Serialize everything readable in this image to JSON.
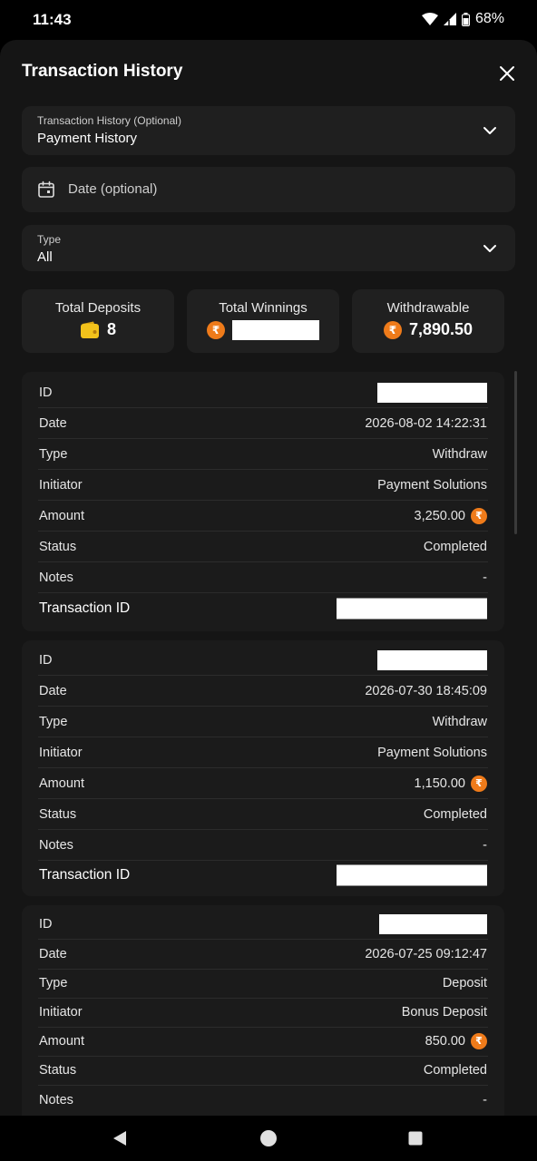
{
  "status_bar": {
    "time": "11:43",
    "battery": "68%"
  },
  "sheet": {
    "title": "Transaction History",
    "sort_field": {
      "label": "Transaction History (Optional)",
      "value": "Payment History"
    },
    "date_field": {
      "placeholder": "Date (optional)"
    },
    "type_field": {
      "label": "Type",
      "value": "All"
    }
  },
  "summary": {
    "deposits": {
      "label": "Total Deposits",
      "value": "8"
    },
    "winnings": {
      "label": "Total Winnings",
      "value": ""
    },
    "withdrawable": {
      "label": "Withdrawable",
      "value": "7,890.50"
    }
  },
  "currency_symbol": "₹",
  "field_labels": {
    "id": "ID",
    "date": "Date",
    "type": "Type",
    "initiator": "Initiator",
    "amount": "Amount",
    "status": "Status",
    "notes": "Notes",
    "transaction_id": "Transaction ID"
  },
  "transactions": [
    {
      "date": "2026-08-02 14:22:31",
      "type": "Withdraw",
      "initiator": "Payment Solutions",
      "amount": "3,250.00",
      "status": "Completed",
      "notes": "-"
    },
    {
      "date": "2026-07-30 18:45:09",
      "type": "Withdraw",
      "initiator": "Payment Solutions",
      "amount": "1,150.00",
      "status": "Completed",
      "notes": "-"
    },
    {
      "date": "2026-07-25 09:12:47",
      "type": "Deposit",
      "initiator": "Bonus Deposit",
      "amount": "850.00",
      "status": "Completed",
      "notes": "-"
    }
  ],
  "colors": {
    "background": "#151515",
    "card": "#1b1b1b",
    "accent_coin": "#ef7b1a",
    "wallet": "#f2c21b"
  },
  "icons": [
    "wifi-icon",
    "signal-icon",
    "battery-icon",
    "close-icon",
    "chevron-down-icon",
    "calendar-icon",
    "wallet-icon",
    "rupee-coin-icon",
    "back-icon",
    "home-icon",
    "recents-icon"
  ]
}
